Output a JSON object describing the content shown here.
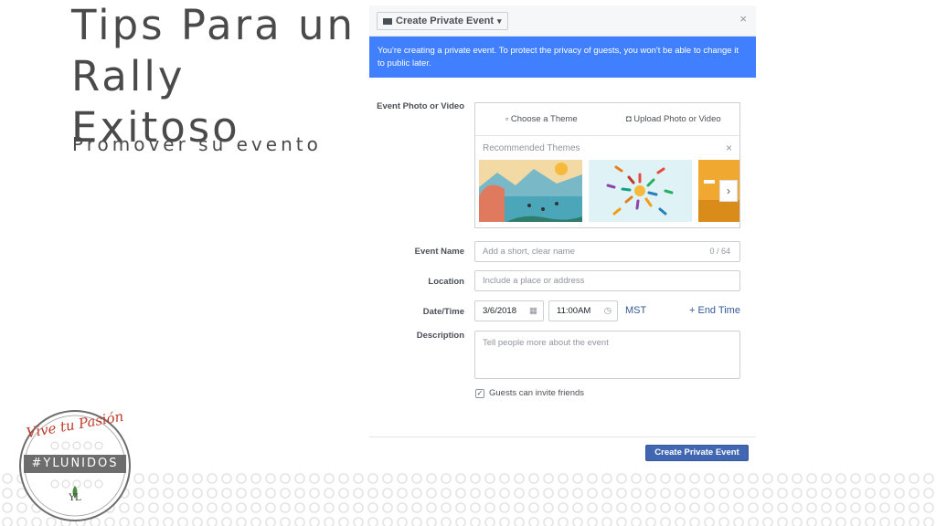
{
  "slide": {
    "title_line1": "Tips Para un",
    "title_line2": "Rally Exitoso",
    "subtitle": "Promover su evento"
  },
  "logo": {
    "script": "Vive tu Pasión",
    "band": "#YLUNIDOS",
    "mark": "YL"
  },
  "dialog": {
    "event_type_label": "Create Private Event",
    "close_icon": "×",
    "banner": "You're creating a private event. To protect the privacy of guests, you won't be able to change it to public later.",
    "photo": {
      "label": "Event Photo or Video",
      "tab_theme": "Choose a Theme",
      "tab_upload": "Upload Photo or Video",
      "recommended_label": "Recommended Themes",
      "next_icon": "›"
    },
    "event_name": {
      "label": "Event Name",
      "placeholder": "Add a short, clear name",
      "counter": "0 / 64"
    },
    "location": {
      "label": "Location",
      "placeholder": "Include a place or address"
    },
    "datetime": {
      "label": "Date/Time",
      "date": "3/6/2018",
      "time": "11:00AM",
      "tz": "MST",
      "end_time": "+ End Time"
    },
    "description": {
      "label": "Description",
      "placeholder": "Tell people more about the event"
    },
    "guests_invite": {
      "label": "Guests can invite friends",
      "checked": true
    },
    "submit_label": "Create Private Event"
  },
  "colors": {
    "banner": "#4080ff",
    "primary_button": "#4267b2",
    "title_text": "#4a4a4a",
    "logo_red": "#c0392b"
  }
}
